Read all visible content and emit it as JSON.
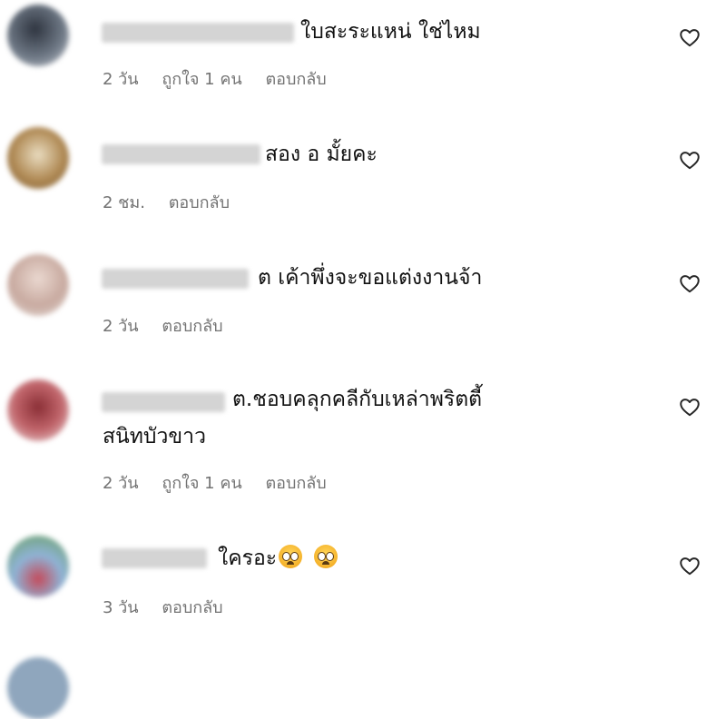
{
  "comments": [
    {
      "text": "ใบสะระแหน่ ใช่ไหม",
      "time": "2 วัน",
      "likes": "ถูกใจ 1 คน",
      "reply": "ตอบกลับ",
      "colors": {
        "avatar": "#5f6b78"
      }
    },
    {
      "text": "สอง อ มั้ยคะ",
      "time": "2 ชม.",
      "reply": "ตอบกลับ",
      "colors": {
        "avatar": "#b08a55"
      }
    },
    {
      "text": "ต เค้าพึ่งจะขอแต่งงานจ้า",
      "time": "2 วัน",
      "reply": "ตอบกลับ",
      "colors": {
        "avatar": "#c8aaa0"
      }
    },
    {
      "text_line1": "ต.ชอบคลุกคลีกับเหล่าพริตตี้",
      "text_line2": "สนิทบัวขาว",
      "time": "2 วัน",
      "likes": "ถูกใจ 1 คน",
      "reply": "ตอบกลับ",
      "colors": {
        "avatar": "#b0545a"
      }
    },
    {
      "text": "ใครอะ",
      "emojis": [
        "pleading-face-emoji",
        "pleading-face-emoji"
      ],
      "time": "3 วัน",
      "reply": "ตอบกลับ",
      "colors": {
        "avatar": "#7fa8c9"
      }
    }
  ],
  "icons": {
    "like": "heart-outline-icon"
  }
}
